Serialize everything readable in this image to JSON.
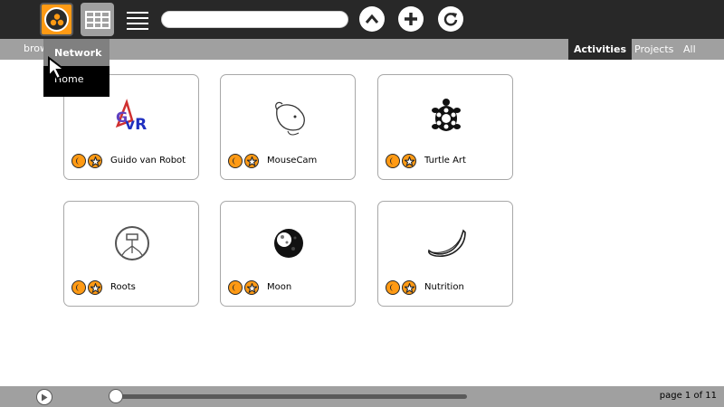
{
  "toolbar": {
    "network_icon": "neighborhood-icon",
    "grid_icon": "grid-view-icon",
    "list_icon": "list-view-icon",
    "search_value": "",
    "up_icon": "chevron-up-icon",
    "add_icon": "plus-icon",
    "refresh_icon": "refresh-icon"
  },
  "subbar": {
    "left_text": "brow            ies",
    "tabs": [
      "Activities",
      "Projects",
      "All"
    ],
    "active_tab": "Activities"
  },
  "palette": {
    "title": "Network",
    "items": [
      "Home"
    ]
  },
  "activities": [
    {
      "name": "Guido van Robot",
      "icon": "gvr-icon"
    },
    {
      "name": "MouseCam",
      "icon": "mouse-icon"
    },
    {
      "name": "Turtle Art",
      "icon": "turtle-icon"
    },
    {
      "name": "Roots",
      "icon": "roots-icon"
    },
    {
      "name": "Moon",
      "icon": "moon-icon"
    },
    {
      "name": "Nutrition",
      "icon": "banana-icon"
    }
  ],
  "pagination": {
    "text": "page 1 of 11",
    "progress_fraction": 0.0
  },
  "colors": {
    "toolbar_bg": "#282828",
    "accent": "#ff9a14",
    "bar_gray": "#a0a0a0"
  }
}
